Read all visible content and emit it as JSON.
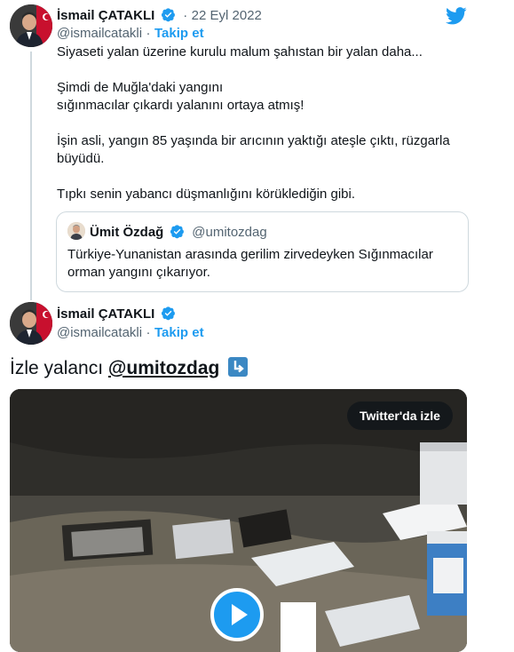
{
  "colors": {
    "accent": "#1d9bf0",
    "text": "#0f1419",
    "muted": "#536471",
    "border": "#cfd9de"
  },
  "tweet1": {
    "author_name": "İsmail ÇATAKLI",
    "separator": "·",
    "date": "22 Eyl 2022",
    "handle": "@ismailcatakli",
    "follow_sep": "·",
    "follow_label": "Takip et",
    "lines": [
      "Siyaseti yalan üzerine kurulu malum şahıstan bir yalan daha...",
      "Şimdi de Muğla'daki yangını",
      "sığınmacılar çıkardı yalanını ortaya atmış!",
      "İşin asli, yangın 85 yaşında bir arıcının yaktığı ateşle çıktı, rüzgarla",
      "büyüdü.",
      "Tıpkı senin yabancı düşmanlığını körüklediğin gibi."
    ],
    "quote": {
      "author_name": "Ümit Özdağ",
      "handle": "@umitozdag",
      "lines": [
        "Türkiye-Yunanistan arasında gerilim zirvedeyken Sığınmacılar",
        "orman yangını çıkarıyor."
      ]
    }
  },
  "tweet2": {
    "author_name": "İsmail ÇATAKLI",
    "handle": "@ismailcatakli",
    "follow_sep": "·",
    "follow_label": "Takip et",
    "text_prefix": "İzle yalancı ",
    "mention": "@umitozdag",
    "media": {
      "watch_label": "Twitter'da izle"
    }
  },
  "icons": [
    "twitter-bird-icon",
    "verified-badge-icon",
    "arrow-down-right-emoji-icon",
    "play-icon"
  ]
}
